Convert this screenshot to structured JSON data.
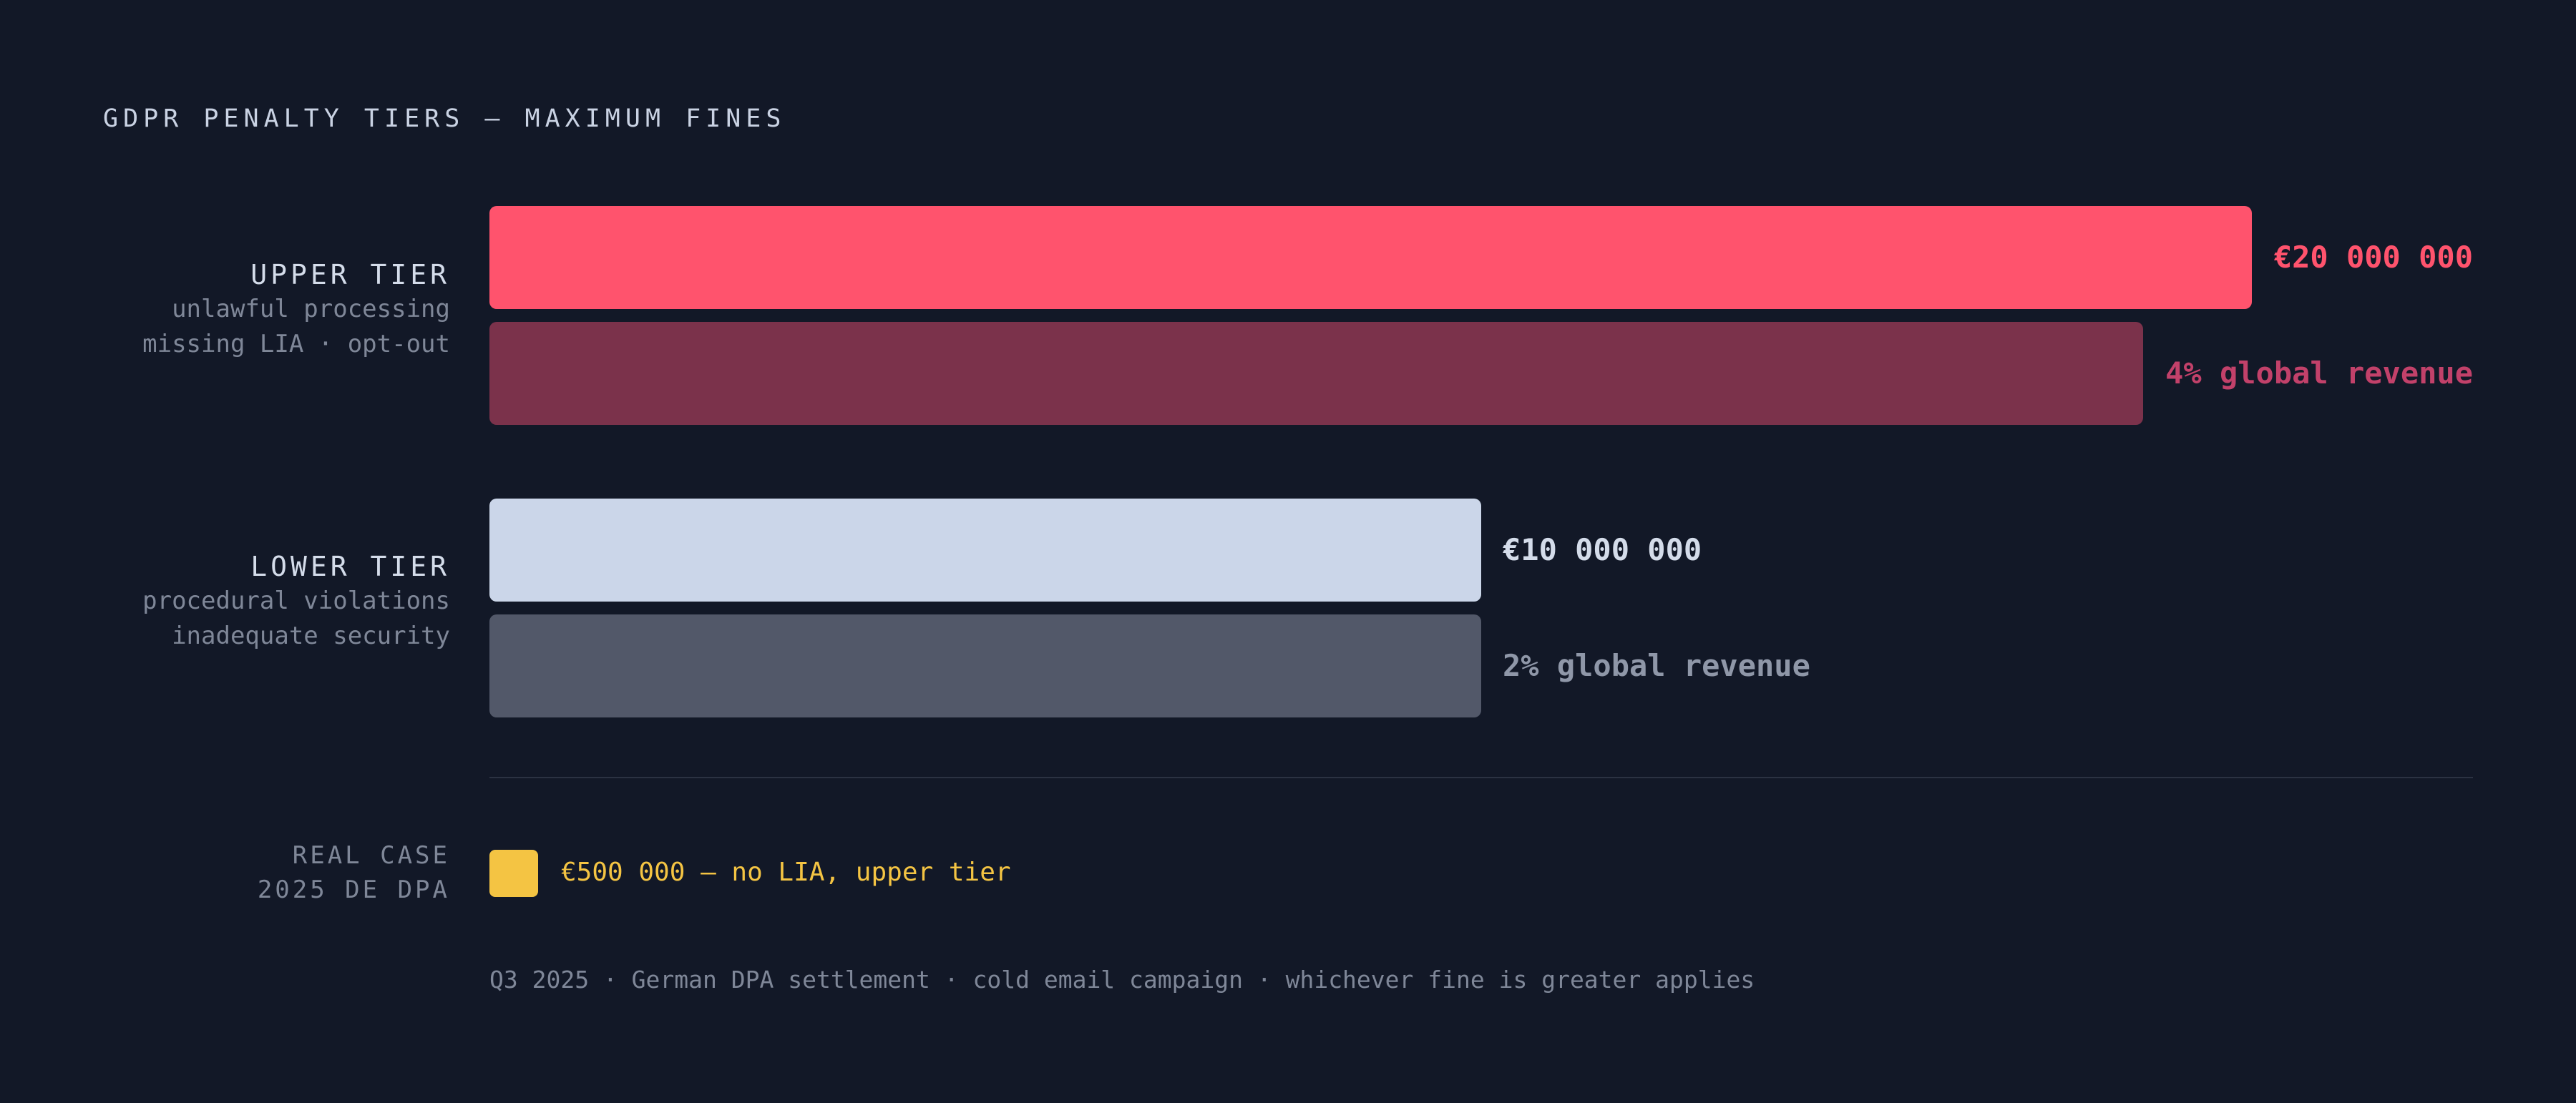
{
  "title": "GDPR PENALTY TIERS — MAXIMUM FINES",
  "colors": {
    "background": "#121827",
    "upper_fixed": "#ff536d",
    "upper_percent": "#7b324b",
    "lower_fixed": "#cbd6e9",
    "lower_percent": "#525869",
    "real_case": "#f4c443"
  },
  "tiers": [
    {
      "name": "UPPER TIER",
      "desc_lines": [
        "unlawful processing",
        "missing LIA · opt-out"
      ],
      "bars": [
        {
          "label": "€20 000 000",
          "value": 20000000
        },
        {
          "label": "4% global revenue",
          "relative": 0.938
        }
      ]
    },
    {
      "name": "LOWER TIER",
      "desc_lines": [
        "procedural violations",
        "inadequate security"
      ],
      "bars": [
        {
          "label": "€10 000 000",
          "value": 10000000
        },
        {
          "label": "2% global revenue",
          "relative": 0.563
        }
      ]
    }
  ],
  "real_case": {
    "label_lines": [
      "REAL CASE",
      "2025 DE DPA"
    ],
    "text": "€500 000 — no LIA, upper tier"
  },
  "footnote": "Q3 2025 · German DPA settlement · cold email campaign · whichever fine is greater applies",
  "chart_data": {
    "type": "bar",
    "orientation": "horizontal",
    "title": "GDPR PENALTY TIERS — MAXIMUM FINES",
    "categories": [
      "UPPER TIER",
      "LOWER TIER"
    ],
    "series": [
      {
        "values": [
          20000000,
          10000000
        ],
        "labels": [
          "€20 000 000",
          "€10 000 000"
        ]
      },
      {
        "labels": [
          "4% global revenue",
          "2% global revenue"
        ]
      }
    ],
    "annotation": "€500 000 — no LIA, upper tier"
  }
}
